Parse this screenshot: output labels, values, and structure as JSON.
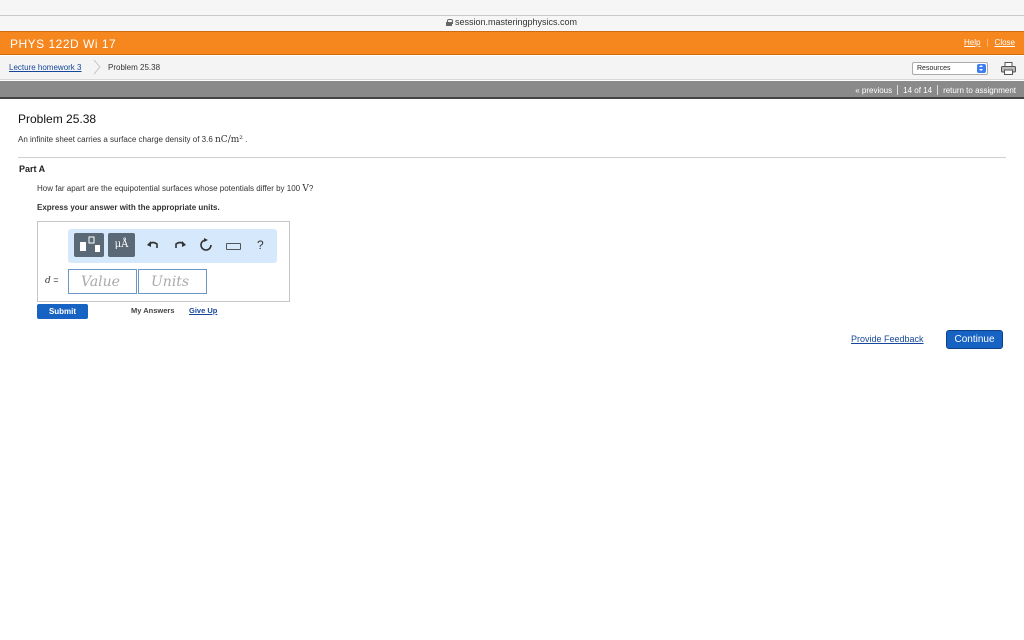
{
  "browser": {
    "url": "session.masteringphysics.com"
  },
  "header": {
    "course_title": "PHYS 122D Wi 17",
    "help_label": "Help",
    "separator": "|",
    "close_label": "Close"
  },
  "breadcrumb": {
    "assignment_link": "Lecture homework 3",
    "current_item": "Problem 25.38",
    "resources_selected": "Resources"
  },
  "nav": {
    "previous_label": "« previous",
    "position": "14 of 14",
    "return_label": "return to assignment"
  },
  "problem": {
    "title": "Problem 25.38",
    "description_text": "An infinite sheet carries a surface charge density of 3.6",
    "description_unit": "nC/m²",
    "description_end": "."
  },
  "part_a": {
    "label": "Part A",
    "question_text": "How far apart are the equipotential surfaces whose potentials differ by 100",
    "question_unit": "V",
    "question_end": "?",
    "instruction": "Express your answer with the appropriate units.",
    "toolbar": {
      "units_button_label": "μÅ",
      "help_label": "?"
    },
    "variable_label": "d",
    "equals": "=",
    "value_placeholder": "Value",
    "units_placeholder": "Units",
    "submit_label": "Submit",
    "my_answers_label": "My Answers",
    "give_up_label": "Give Up"
  },
  "footer": {
    "feedback_label": "Provide Feedback",
    "continue_label": "Continue"
  },
  "colors": {
    "brand_orange": "#f6871f",
    "primary_blue": "#1763c4",
    "link_blue": "#15479a",
    "toolbar_bg": "#d6e8fb"
  }
}
